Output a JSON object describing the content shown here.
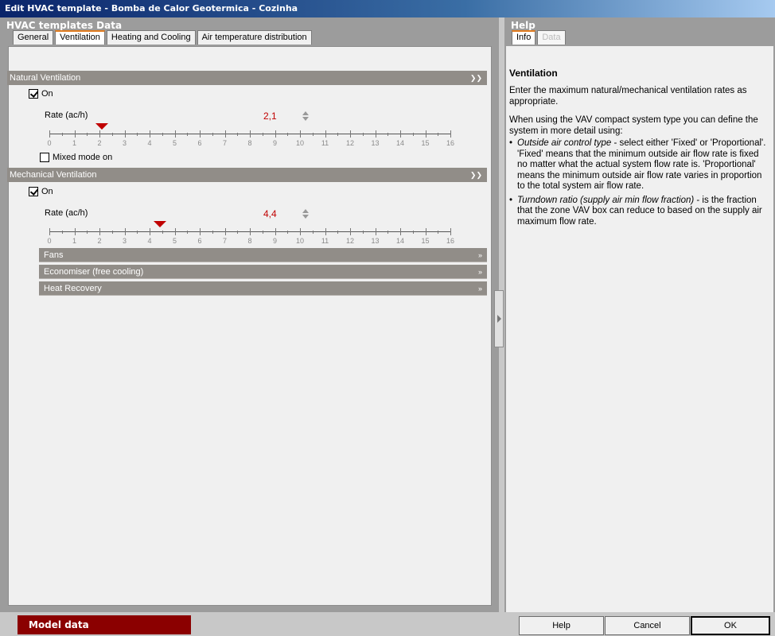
{
  "window": {
    "title": "Edit HVAC template - Bomba de Calor Geotermica - Cozinha"
  },
  "left_panel": {
    "header": "HVAC templates Data",
    "tabs": [
      {
        "label": "General",
        "active": false
      },
      {
        "label": "Ventilation",
        "active": true
      },
      {
        "label": "Heating and Cooling",
        "active": false
      },
      {
        "label": "Air temperature distribution",
        "active": false
      }
    ]
  },
  "natural_ventilation": {
    "title": "Natural Ventilation",
    "collapse_icon": "double-chevron-down-icon",
    "on_label": "On",
    "on_checked": true,
    "rate_label": "Rate (ac/h)",
    "rate_value": "2,1",
    "rate_number": 2.1,
    "slider_min": 0,
    "slider_max": 16,
    "mixed_mode_label": "Mixed mode on",
    "mixed_mode_checked": false
  },
  "mechanical_ventilation": {
    "title": "Mechanical Ventilation",
    "collapse_icon": "double-chevron-down-icon",
    "on_label": "On",
    "on_checked": true,
    "rate_label": "Rate (ac/h)",
    "rate_value": "4,4",
    "rate_number": 4.4,
    "slider_min": 0,
    "slider_max": 16,
    "subsections": [
      {
        "label": "Fans"
      },
      {
        "label": "Economiser (free cooling)"
      },
      {
        "label": "Heat Recovery"
      }
    ]
  },
  "slider_ticks": [
    "0",
    "1",
    "2",
    "3",
    "4",
    "5",
    "6",
    "7",
    "8",
    "9",
    "10",
    "11",
    "12",
    "13",
    "14",
    "15",
    "16"
  ],
  "help_panel": {
    "header": "Help",
    "tabs": [
      {
        "label": "Info",
        "active": true
      },
      {
        "label": "Data",
        "active": false
      }
    ],
    "title": "Ventilation",
    "para1": "Enter the maximum natural/mechanical ventilation rates as appropriate.",
    "para2": "When using the VAV compact system type you can define the system in more detail using:",
    "bullet1_term": "Outside air control type",
    "bullet1_text": " - select either 'Fixed' or 'Proportional'. 'Fixed' means that the minimum outside air flow rate is fixed no matter what the actual system flow rate is. 'Proportional' means the minimum outside air flow rate varies in proportion to the total system air flow rate.",
    "bullet2_term": "Turndown ratio (supply air min flow fraction)",
    "bullet2_text": " - is the fraction that the zone VAV box can reduce to based on the supply air maximum flow rate."
  },
  "footer": {
    "model_data": "Model data",
    "help": "Help",
    "cancel": "Cancel",
    "ok": "OK"
  },
  "colors": {
    "accent_tab": "#e07b1e",
    "rate_value": "#c00000",
    "model_data_bg": "#8b0000",
    "section_bar": "#918d88"
  }
}
